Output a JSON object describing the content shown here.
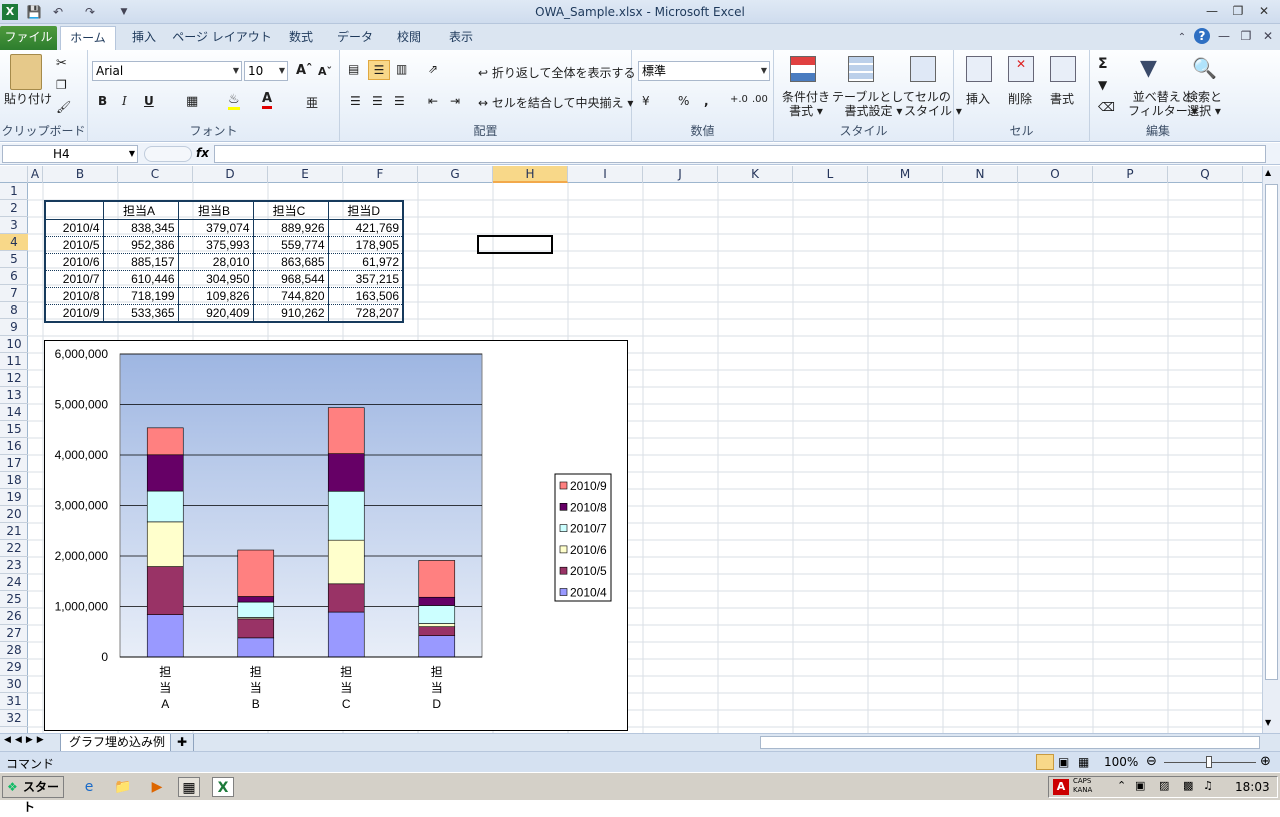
{
  "window": {
    "title": "OWA_Sample.xlsx  -  Microsoft Excel"
  },
  "tabs": [
    {
      "label": "ファイル"
    },
    {
      "label": "ホーム"
    },
    {
      "label": "挿入"
    },
    {
      "label": "ページ レイアウト"
    },
    {
      "label": "数式"
    },
    {
      "label": "データ"
    },
    {
      "label": "校閲"
    },
    {
      "label": "表示"
    }
  ],
  "ribbon": {
    "clipboard": {
      "label": "クリップボード",
      "paste": "貼り付け"
    },
    "font": {
      "label": "フォント",
      "font_name": "Arial",
      "font_size": "10"
    },
    "alignment": {
      "label": "配置",
      "wrap_text": "折り返して全体を表示する",
      "merge_center": "セルを結合して中央揃え"
    },
    "number": {
      "label": "数値",
      "format": "標準"
    },
    "styles": {
      "label": "スタイル",
      "cond_format_1": "条件付き",
      "cond_format_2": "書式",
      "table_format_1": "テーブルとして",
      "table_format_2": "書式設定",
      "cell_styles_1": "セルの",
      "cell_styles_2": "スタイル"
    },
    "cells": {
      "label": "セル",
      "insert": "挿入",
      "delete": "削除",
      "format": "書式"
    },
    "editing": {
      "label": "編集",
      "sort_1": "並べ替えと",
      "sort_2": "フィルター",
      "find_1": "検索と",
      "find_2": "選択"
    }
  },
  "formula_bar": {
    "name_box": "H4",
    "fx": "fx",
    "formula": ""
  },
  "columns": [
    "A",
    "B",
    "C",
    "D",
    "E",
    "F",
    "G",
    "H",
    "I",
    "J",
    "K",
    "L",
    "M",
    "N",
    "O",
    "P",
    "Q"
  ],
  "selected_column": "H",
  "rows": [
    "1",
    "2",
    "3",
    "4",
    "5",
    "6",
    "7",
    "8",
    "9",
    "10",
    "11",
    "12",
    "13",
    "14",
    "15",
    "16",
    "17",
    "18",
    "19",
    "20",
    "21",
    "22",
    "23",
    "24",
    "25",
    "26",
    "27",
    "28",
    "29",
    "30",
    "31",
    "32"
  ],
  "selected_row": "4",
  "table": {
    "headers": [
      "",
      "担当A",
      "担当B",
      "担当C",
      "担当D"
    ],
    "rows": [
      [
        "2010/4",
        "838,345",
        "379,074",
        "889,926",
        "421,769"
      ],
      [
        "2010/5",
        "952,386",
        "375,993",
        "559,774",
        "178,905"
      ],
      [
        "2010/6",
        "885,157",
        "28,010",
        "863,685",
        "61,972"
      ],
      [
        "2010/7",
        "610,446",
        "304,950",
        "968,544",
        "357,215"
      ],
      [
        "2010/8",
        "718,199",
        "109,826",
        "744,820",
        "163,506"
      ],
      [
        "2010/9",
        "533,365",
        "920,409",
        "910,262",
        "728,207"
      ]
    ]
  },
  "chart_data": {
    "type": "bar",
    "stacked": true,
    "categories": [
      "担当A",
      "担当B",
      "担当C",
      "担当D"
    ],
    "series": [
      {
        "name": "2010/4",
        "color": "#9999ff",
        "values": [
          838345,
          379074,
          889926,
          421769
        ]
      },
      {
        "name": "2010/5",
        "color": "#993366",
        "values": [
          952386,
          375993,
          559774,
          178905
        ]
      },
      {
        "name": "2010/6",
        "color": "#ffffcc",
        "values": [
          885157,
          28010,
          863685,
          61972
        ]
      },
      {
        "name": "2010/7",
        "color": "#ccffff",
        "values": [
          610446,
          304950,
          968544,
          357215
        ]
      },
      {
        "name": "2010/8",
        "color": "#660066",
        "values": [
          718199,
          109826,
          744820,
          163506
        ]
      },
      {
        "name": "2010/9",
        "color": "#ff8080",
        "values": [
          533365,
          920409,
          910262,
          728207
        ]
      }
    ],
    "yticks": [
      "0",
      "1,000,000",
      "2,000,000",
      "3,000,000",
      "4,000,000",
      "5,000,000",
      "6,000,000"
    ],
    "ylim": [
      0,
      6000000
    ],
    "grid": true,
    "legend_position": "right",
    "title": "",
    "xlabel": "",
    "ylabel": ""
  },
  "sheet_tabs": [
    {
      "label": "グラフ埋め込み例"
    }
  ],
  "status": {
    "mode": "コマンド",
    "zoom": "100%"
  },
  "taskbar": {
    "start": "スタート",
    "time": "18:03",
    "caps": "CAPS",
    "kana": "KANA"
  }
}
